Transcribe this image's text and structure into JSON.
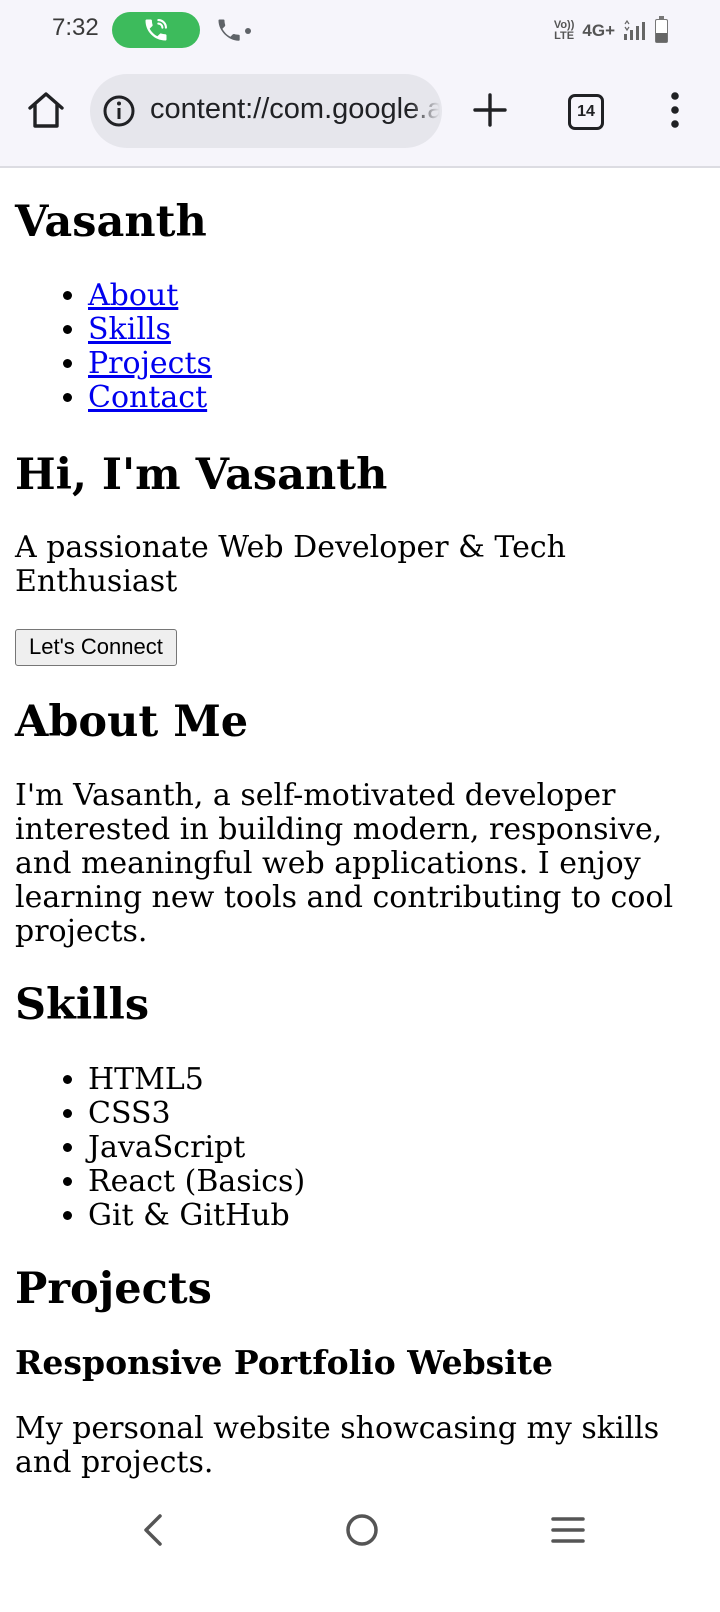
{
  "status_bar": {
    "time": "7:32",
    "volte_top": "Vo))",
    "volte_bottom": "LTE",
    "network": "4G+",
    "call_pill_color": "#3dbb5c",
    "battery_level": 0.4
  },
  "browser": {
    "url": "content://com.google.android.apps.docs.storage/document/portfolio.html",
    "tab_count": "14",
    "icons": [
      "home-icon",
      "info-icon",
      "plus-icon",
      "tab-switcher-icon",
      "more-vert-icon"
    ]
  },
  "page": {
    "site_title": "Vasanth",
    "nav_links": [
      "About",
      "Skills",
      "Projects",
      "Contact"
    ],
    "link_color": "#0000ee",
    "hero_title": "Hi, I'm Vasanth",
    "hero_subtitle": "A passionate Web Developer & Tech Enthusiast",
    "connect_button": "Let's Connect",
    "about_title": "About Me",
    "about_text": "I'm Vasanth, a self-motivated developer interested in building modern, responsive, and meaningful web applications. I enjoy learning new tools and contributing to cool projects.",
    "skills_title": "Skills",
    "skills": [
      "HTML5",
      "CSS3",
      "JavaScript",
      "React (Basics)",
      "Git & GitHub"
    ],
    "projects_title": "Projects",
    "project_title": "Responsive Portfolio Website",
    "project_desc": "My personal website showcasing my skills and projects."
  },
  "nav_bar": {
    "icons": [
      "back-icon",
      "home-circle-icon",
      "recents-icon"
    ]
  }
}
